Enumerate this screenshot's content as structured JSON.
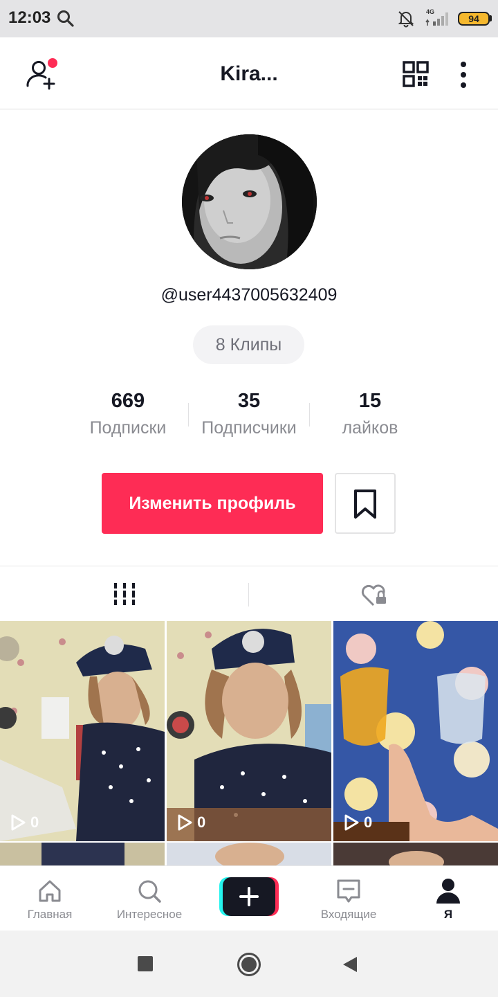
{
  "status_bar": {
    "time": "12:03",
    "network": "4G",
    "battery": "94",
    "icons": [
      "search-icon",
      "bell-muted-icon",
      "signal-icon",
      "battery-icon"
    ]
  },
  "header": {
    "title": "Kira...",
    "icons": [
      "add-user-icon",
      "qr-code-icon",
      "more-vertical-icon"
    ],
    "notification_dot_color": "#fe2c55"
  },
  "profile": {
    "username": "@user4437005632409",
    "clips_label": "8 Клипы",
    "stats": [
      {
        "value": "669",
        "label": "Подписки"
      },
      {
        "value": "35",
        "label": "Подписчики"
      },
      {
        "value": "15",
        "label": "лайков"
      }
    ],
    "edit_button": "Изменить профиль",
    "accent_color": "#fe2c55"
  },
  "tabs": {
    "items": [
      {
        "icon": "grid-icon",
        "active": true
      },
      {
        "icon": "liked-private-icon",
        "active": false
      }
    ]
  },
  "videos": [
    {
      "views": "0",
      "icon": "play-icon"
    },
    {
      "views": "0",
      "icon": "play-icon"
    },
    {
      "views": "0",
      "icon": "play-icon"
    }
  ],
  "bottom_nav": {
    "items": [
      {
        "label": "Главная",
        "icon": "home-icon",
        "active": false
      },
      {
        "label": "Интересное",
        "icon": "discover-icon",
        "active": false
      },
      {
        "label": "",
        "icon": "create-plus-icon",
        "active": false
      },
      {
        "label": "Входящие",
        "icon": "inbox-icon",
        "active": false
      },
      {
        "label": "Я",
        "icon": "profile-icon",
        "active": true
      }
    ]
  }
}
